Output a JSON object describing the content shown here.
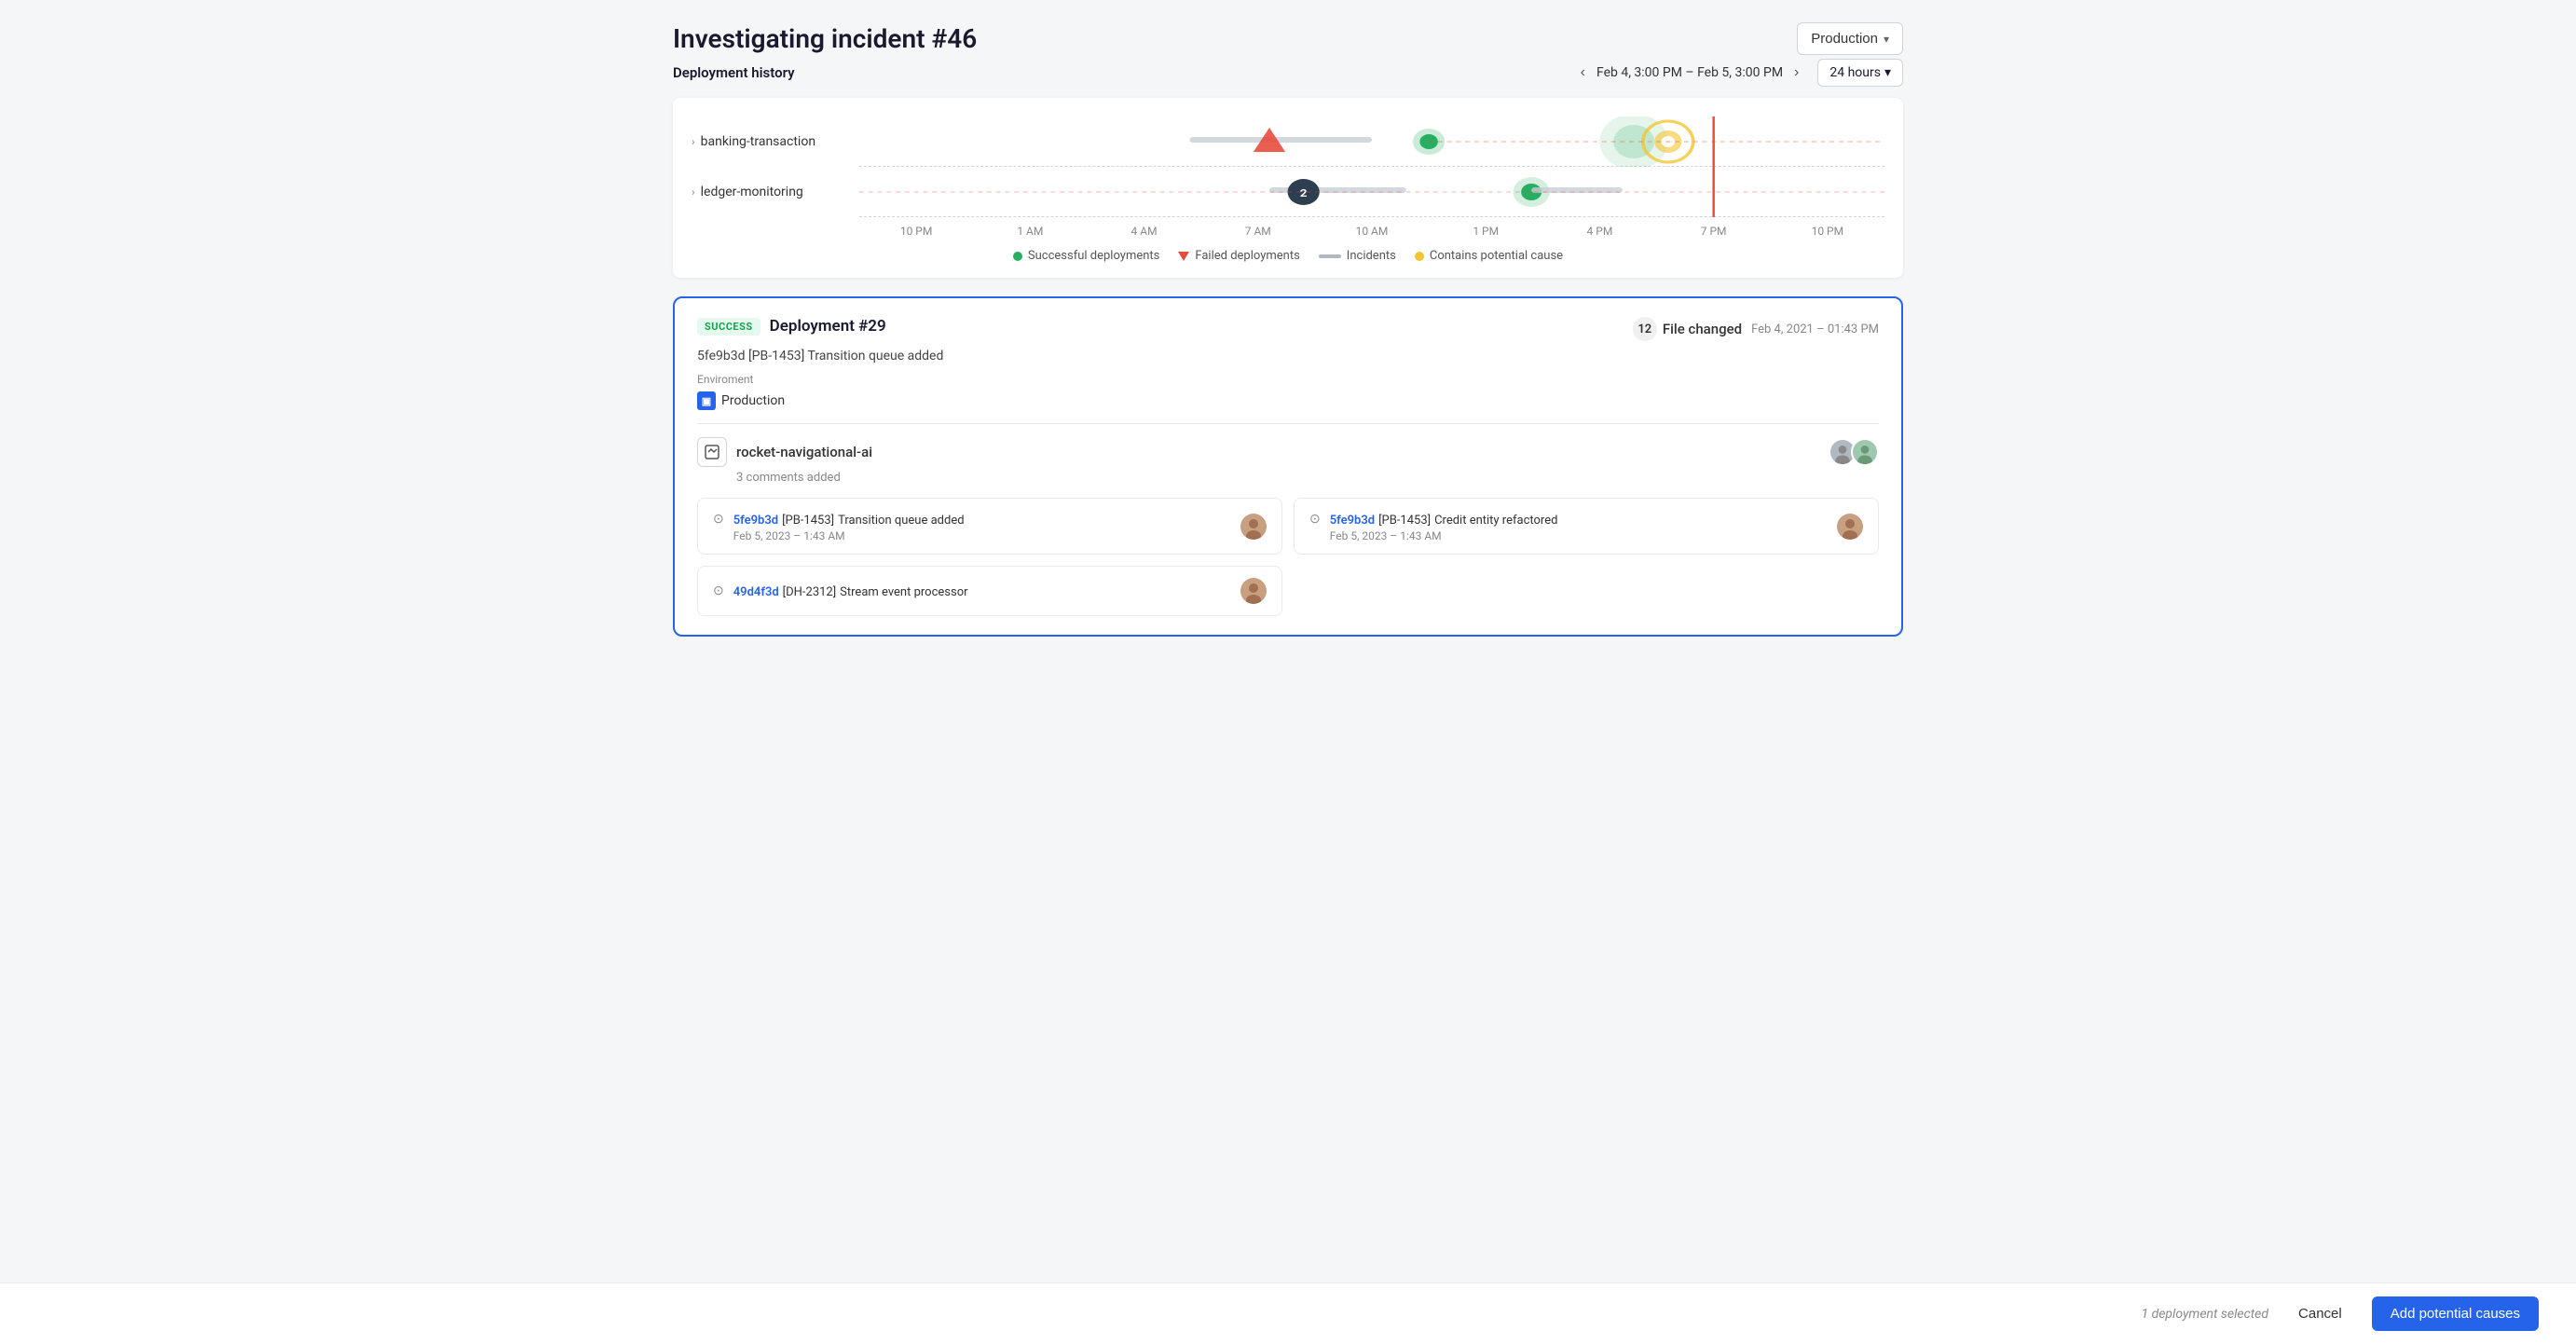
{
  "page": {
    "title": "Investigating incident #46"
  },
  "env_selector": {
    "label": "Production",
    "chevron": "▾"
  },
  "deployment_history": {
    "section_title": "Deployment history",
    "time_range": "Feb 4, 3:00 PM – Feb 5, 3:00 PM",
    "time_period": "24 hours",
    "time_labels": [
      "10 PM",
      "1 AM",
      "4 AM",
      "7 AM",
      "10 AM",
      "1 PM",
      "4 PM",
      "7 PM",
      "10 PM"
    ],
    "rows": [
      {
        "label": "banking-transaction"
      },
      {
        "label": "ledger-monitoring"
      }
    ],
    "legend": [
      {
        "type": "dot",
        "color": "#27ae60",
        "label": "Successful deployments"
      },
      {
        "type": "triangle",
        "color": "#e74c3c",
        "label": "Failed deployments"
      },
      {
        "type": "line",
        "color": "#b0b8c1",
        "label": "Incidents"
      },
      {
        "type": "dot",
        "color": "#f4c430",
        "label": "Contains potential cause"
      }
    ]
  },
  "deployment_card": {
    "status": "SUCCESS",
    "name": "Deployment #29",
    "commit": "5fe9b3d [PB-1453] Transition queue added",
    "file_count": "12",
    "file_label": "File changed",
    "date": "Feb 4, 2021 – 01:43 PM",
    "env_label": "Enviroment",
    "env_name": "Production",
    "service_name": "rocket-navigational-ai",
    "comments": "3 comments added",
    "commits": [
      {
        "hash": "5fe9b3d",
        "tag": "[PB-1453]",
        "message": "Transition queue added",
        "date": "Feb 5, 2023 – 1:43 AM"
      },
      {
        "hash": "5fe9b3d",
        "tag": "[PB-1453]",
        "message": "Credit entity refactored",
        "date": "Feb 5, 2023 – 1:43 AM"
      },
      {
        "hash": "49d4f3d",
        "tag": "[DH-2312]",
        "message": "Stream event processor",
        "date": ""
      }
    ]
  },
  "bottom_bar": {
    "selected_text": "1 deployment selected",
    "cancel_label": "Cancel",
    "add_label": "Add potential causes"
  }
}
